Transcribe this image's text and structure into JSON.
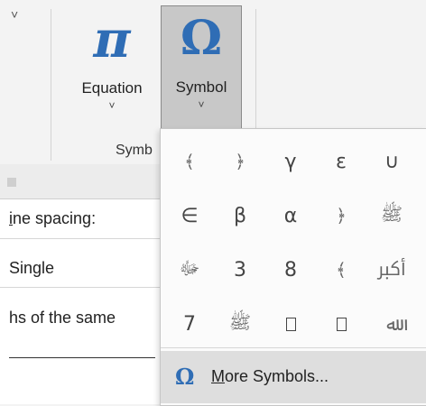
{
  "ribbon": {
    "chevron": "˅",
    "equation": {
      "icon": "π",
      "icon_name": "pi-icon",
      "label": "Equation",
      "arrow": "˅"
    },
    "symbol": {
      "icon": "Ω",
      "icon_name": "omega-icon",
      "label": "Symbol",
      "arrow": "˅"
    },
    "group_label": "Symb"
  },
  "document": {
    "line_spacing_label": "ine spacing:",
    "line_spacing_prefix": "i",
    "single_value": "Single",
    "same_text": "hs of the same"
  },
  "symbol_dropdown": {
    "symbols": [
      [
        "﴾",
        "﴿",
        "γ",
        "ε",
        "∪"
      ],
      [
        "∈",
        "β",
        "α",
        "﴿",
        "ﷺ"
      ],
      [
        "ﷻ",
        "3",
        "8",
        "﴾",
        "ﷳ"
      ],
      [
        "7",
        "ﷺ",
        "",
        "",
        "ﷲ"
      ]
    ],
    "more_icon": "Ω",
    "more_label_underlined": "M",
    "more_label_rest": "ore Symbols..."
  },
  "colors": {
    "accent": "#2f6db5",
    "selected_button": "#c8c8c8",
    "hover_row": "#dedede"
  }
}
